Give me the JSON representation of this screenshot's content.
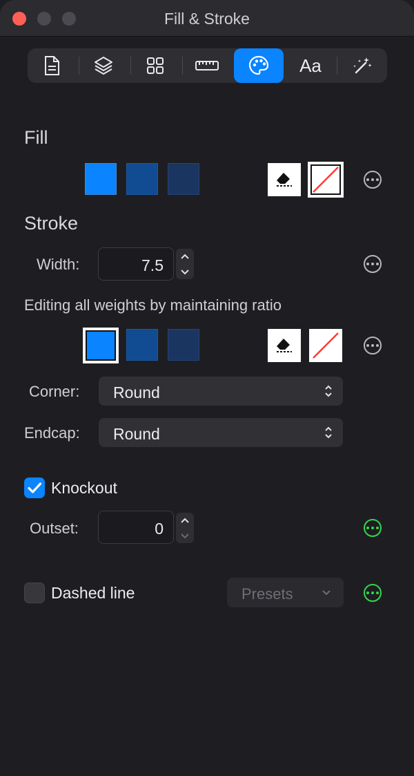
{
  "window": {
    "title": "Fill & Stroke"
  },
  "toolbar": {
    "items": [
      {
        "icon": "document-icon"
      },
      {
        "icon": "layers-icon"
      },
      {
        "icon": "grid-icon"
      },
      {
        "icon": "ruler-icon"
      },
      {
        "icon": "palette-icon",
        "active": true
      },
      {
        "icon": "text-icon",
        "label": "Aa"
      },
      {
        "icon": "magic-wand-icon"
      }
    ]
  },
  "fill": {
    "title": "Fill",
    "swatch_colors": [
      "#0a84ff",
      "#114b92",
      "#1a3660"
    ]
  },
  "stroke": {
    "title": "Stroke",
    "width_label": "Width:",
    "width_value": "7.5",
    "ratio_note": "Editing all weights by maintaining ratio",
    "swatch_colors": [
      "#0a84ff",
      "#114b92",
      "#1a3660"
    ],
    "corner_label": "Corner:",
    "corner_value": "Round",
    "endcap_label": "Endcap:",
    "endcap_value": "Round"
  },
  "knockout": {
    "label": "Knockout",
    "checked": true,
    "outset_label": "Outset:",
    "outset_value": "0"
  },
  "dashed": {
    "label": "Dashed line",
    "checked": false,
    "presets_label": "Presets"
  },
  "colors": {
    "accent": "#0a84ff",
    "active_more": "#32d74b",
    "none_slash": "#ff3b30"
  }
}
